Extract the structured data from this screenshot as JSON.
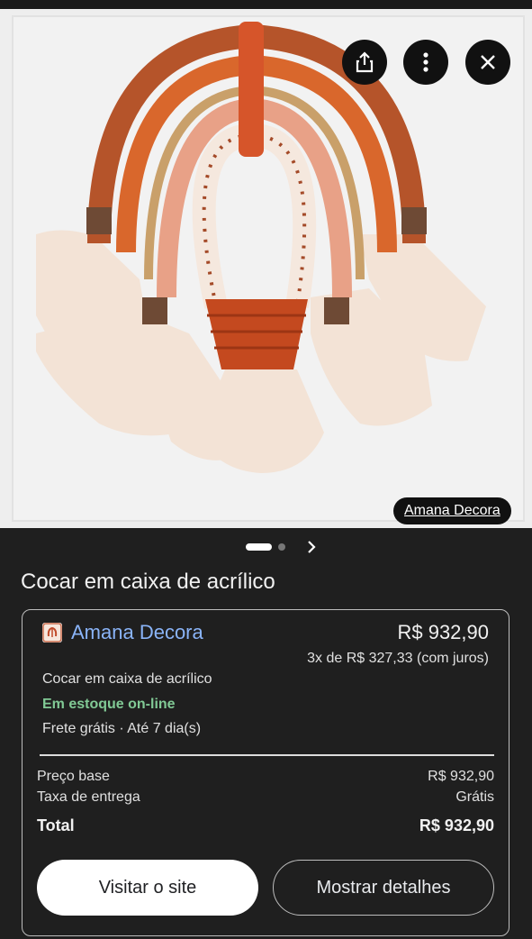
{
  "hero": {
    "image_alt": "Cocar em caixa de acrílico",
    "source_label": "Amana Decora",
    "icons": [
      "share-icon",
      "more-vert-icon",
      "close-icon"
    ]
  },
  "carousel": {
    "current_page": 1,
    "total_pages": 2
  },
  "product": {
    "title": "Cocar em caixa de acrílico"
  },
  "offer": {
    "merchant": "Amana Decora",
    "price": "R$ 932,90",
    "installments": "3x de R$ 327,33 (com juros)",
    "product_name": "Cocar em caixa de acrílico",
    "stock": "Em estoque on-line",
    "shipping": "Frete grátis · Até 7 dia(s)",
    "breakdown": {
      "base_label": "Preço base",
      "base_value": "R$ 932,90",
      "delivery_label": "Taxa de entrega",
      "delivery_value": "Grátis",
      "total_label": "Total",
      "total_value": "R$ 932,90"
    },
    "visit_button": "Visitar o site",
    "details_button": "Mostrar detalhes"
  },
  "colors": {
    "accent_link": "#8ab4f8",
    "stock_green": "#81c995",
    "background": "#1f1f1f"
  }
}
